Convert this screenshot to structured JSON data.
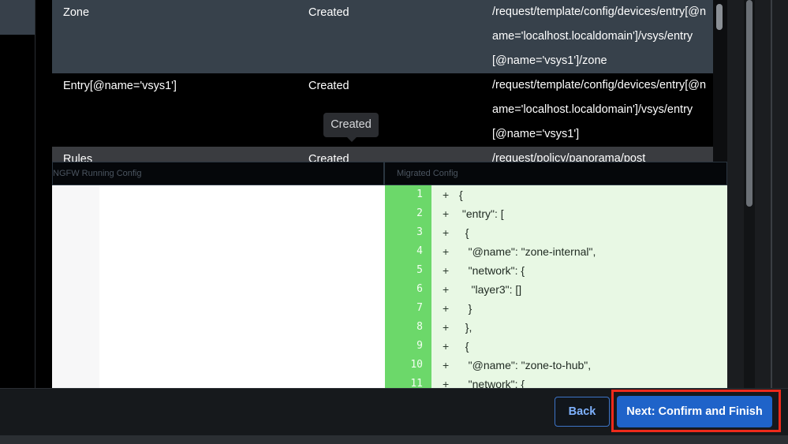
{
  "table": {
    "rows": [
      {
        "name": "Zone",
        "status": "Created",
        "path": "/request/template/config/devices/entry[@name='localhost.localdomain']/vsys/entry[@name='vsys1']/zone"
      },
      {
        "name": "Entry[@name='vsys1']",
        "status": "Created",
        "path": "/request/template/config/devices/entry[@name='localhost.localdomain']/vsys/entry[@name='vsys1']"
      },
      {
        "name": "Rules",
        "status": "Created",
        "path": "/request/policy/panorama/post"
      }
    ]
  },
  "tooltip": {
    "text": "Created"
  },
  "diff": {
    "left_header": "NGFW Running Config",
    "right_header": "Migrated Config",
    "lines": [
      {
        "num": "1",
        "sign": "+",
        "code": "{"
      },
      {
        "num": "2",
        "sign": "+",
        "code": " \"entry\": ["
      },
      {
        "num": "3",
        "sign": "+",
        "code": "  {"
      },
      {
        "num": "4",
        "sign": "+",
        "code": "   \"@name\": \"zone-internal\","
      },
      {
        "num": "5",
        "sign": "+",
        "code": "   \"network\": {"
      },
      {
        "num": "6",
        "sign": "+",
        "code": "    \"layer3\": []"
      },
      {
        "num": "7",
        "sign": "+",
        "code": "   }"
      },
      {
        "num": "8",
        "sign": "+",
        "code": "  },"
      },
      {
        "num": "9",
        "sign": "+",
        "code": "  {"
      },
      {
        "num": "10",
        "sign": "+",
        "code": "   \"@name\": \"zone-to-hub\","
      },
      {
        "num": "11",
        "sign": "+",
        "code": "   \"network\": {"
      }
    ]
  },
  "footer": {
    "back_label": "Back",
    "next_label": "Next: Confirm and Finish"
  }
}
